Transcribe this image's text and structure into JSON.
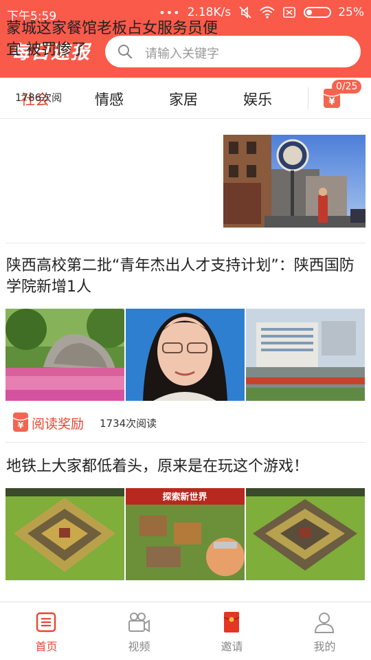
{
  "status_bar": {
    "time": "下午5:59",
    "dots": "•••",
    "speed": "2.18K/s",
    "battery": "25%",
    "battery_level": 0.25
  },
  "header": {
    "logo": "每日速报",
    "search_placeholder": "请输入关键字"
  },
  "tabs": {
    "items": [
      "社会",
      "情感",
      "家居",
      "娱乐"
    ],
    "active_index": 0,
    "reward_count": "0/25"
  },
  "articles": [
    {
      "title": "蒙城这家餐馆老板占女服务员便宜 被罚惨了",
      "meta": "1786次阅",
      "thumb": "restaurant-photo"
    },
    {
      "title": "陕西高校第二批“青年杰出人才支持计划”：陕西国防学院新增1人",
      "badge_label": "阅读奖励",
      "meta": "1734次阅读",
      "thumbs": [
        "campus-rock-photo",
        "portrait-photo",
        "building-aerial-photo"
      ]
    },
    {
      "title": "地铁上大家都低着头，原来是在玩这个游戏！",
      "thumbs": [
        "game-village-screenshot-1",
        "game-banner-screenshot",
        "game-village-screenshot-2"
      ],
      "banner_text": "探索新世界"
    }
  ],
  "bottom_nav": {
    "items": [
      {
        "label": "首页",
        "icon": "home-icon",
        "active": true
      },
      {
        "label": "视频",
        "icon": "video-camera-icon",
        "active": false
      },
      {
        "label": "邀请",
        "icon": "red-envelope-icon",
        "active": false
      },
      {
        "label": "我的",
        "icon": "user-icon",
        "active": false
      }
    ]
  },
  "colors": {
    "brand": "#f95a4a",
    "accent": "#e8452f"
  }
}
